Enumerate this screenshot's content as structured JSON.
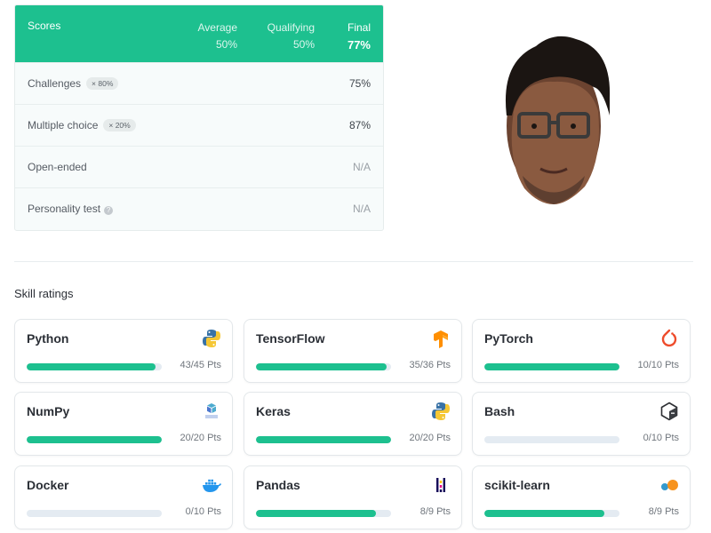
{
  "scores": {
    "title": "Scores",
    "columns": [
      {
        "label": "Average",
        "value": "50%"
      },
      {
        "label": "Qualifying",
        "value": "50%"
      },
      {
        "label": "Final",
        "value": "77%"
      }
    ],
    "rows": [
      {
        "name": "Challenges",
        "tag": "× 80%",
        "value": "75%"
      },
      {
        "name": "Multiple choice",
        "tag": "× 20%",
        "value": "87%"
      },
      {
        "name": "Open-ended",
        "value": "N/A"
      },
      {
        "name": "Personality test",
        "value": "N/A"
      }
    ],
    "accent_color": "#1dc08f"
  },
  "skills": {
    "title": "Skill ratings",
    "items": [
      {
        "name": "Python",
        "points": "43/45 Pts",
        "progress": 0.955,
        "icon": "python-icon"
      },
      {
        "name": "TensorFlow",
        "points": "35/36 Pts",
        "progress": 0.97,
        "icon": "tensorflow-icon"
      },
      {
        "name": "PyTorch",
        "points": "10/10 Pts",
        "progress": 1.0,
        "icon": "pytorch-icon"
      },
      {
        "name": "NumPy",
        "points": "20/20 Pts",
        "progress": 1.0,
        "icon": "numpy-icon"
      },
      {
        "name": "Keras",
        "points": "20/20 Pts",
        "progress": 1.0,
        "icon": "python-icon"
      },
      {
        "name": "Bash",
        "points": "0/10 Pts",
        "progress": 0.0,
        "icon": "bash-icon"
      },
      {
        "name": "Docker",
        "points": "0/10 Pts",
        "progress": 0.0,
        "icon": "docker-icon"
      },
      {
        "name": "Pandas",
        "points": "8/9 Pts",
        "progress": 0.889,
        "icon": "pandas-icon"
      },
      {
        "name": "scikit-learn",
        "points": "8/9 Pts",
        "progress": 0.889,
        "icon": "scikit-learn-icon"
      }
    ]
  }
}
